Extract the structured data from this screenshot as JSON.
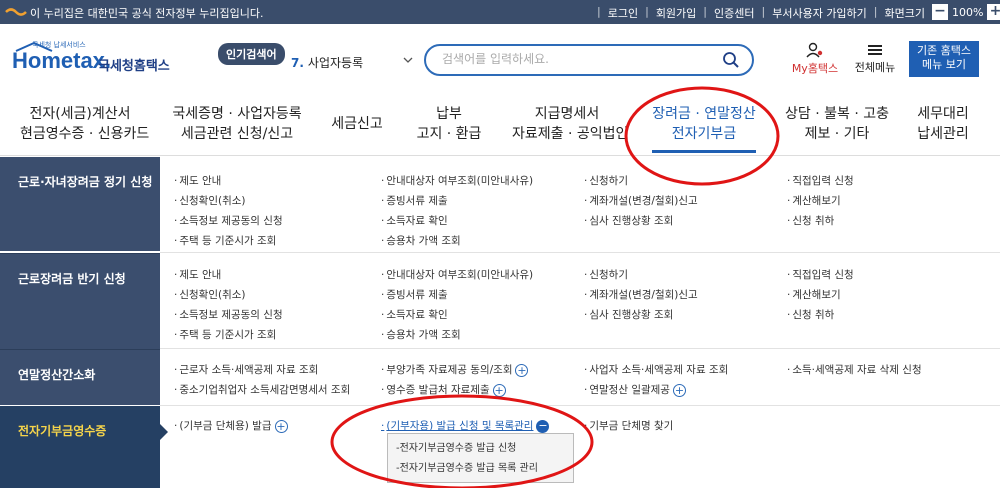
{
  "topbar": {
    "notice": "이 누리집은 대한민국 공식 전자정부 누리집입니다.",
    "links": [
      "로그인",
      "회원가입",
      "인증센터",
      "부서사용자 가입하기",
      "화면크기"
    ],
    "zoom": "100%",
    "zoom_minus": "−",
    "zoom_plus": "+"
  },
  "header": {
    "logo_small": "국세청 납세서비스",
    "logo_home": "Hometax.",
    "logo_org": "국세청홈택스",
    "popular_badge": "인기검색어",
    "popular_rank": "7.",
    "popular_term": "사업자등록",
    "search_placeholder": "검색어를 입력하세요.",
    "mytax": "My홈택스",
    "allmenu": "전체메뉴",
    "oldhome_line1": "기존 홈택스",
    "oldhome_line2": "메뉴 보기"
  },
  "nav": [
    {
      "l1": "전자(세금)계산서",
      "l2": "현금영수증 · 신용카드"
    },
    {
      "l1": "국세증명 · 사업자등록",
      "l2": "세금관련 신청/신고"
    },
    {
      "l1": "세금신고",
      "l2": ""
    },
    {
      "l1": "납부",
      "l2": "고지 · 환급"
    },
    {
      "l1": "지급명세서",
      "l2": "자료제출 · 공익법인"
    },
    {
      "l1": "장려금 · 연말정산",
      "l2": "전자기부금"
    },
    {
      "l1": "상담 · 불복 · 고충",
      "l2": "제보 · 기타"
    },
    {
      "l1": "세무대리",
      "l2": "납세관리"
    }
  ],
  "sections": [
    {
      "title": "근로·자녀장려금 정기 신청",
      "links": [
        "제도 안내",
        "신청확인(취소)",
        "소득정보 제공동의 신청",
        "주택 등 기준시가 조회",
        "안내대상자 여부조회(미안내사유)",
        "증빙서류 제출",
        "소득자료 확인",
        "승용차 가액 조회",
        "신청하기",
        "계좌개설(변경/철회)신고",
        "심사 진행상황 조회",
        "직접입력 신청",
        "계산해보기",
        "신청 취하"
      ]
    },
    {
      "title": "근로장려금 반기 신청",
      "links": [
        "제도 안내",
        "신청확인(취소)",
        "소득정보 제공동의 신청",
        "주택 등 기준시가 조회",
        "안내대상자 여부조회(미안내사유)",
        "증빙서류 제출",
        "소득자료 확인",
        "승용차 가액 조회",
        "신청하기",
        "계좌개설(변경/철회)신고",
        "심사 진행상황 조회",
        "직접입력 신청",
        "계산해보기",
        "신청 취하"
      ]
    },
    {
      "title": "연말정산간소화",
      "links": [
        "근로자 소득·세액공제 자료 조회",
        "중소기업취업자 소득세감면명세서 조회",
        "부양가족 자료제공 동의/조회",
        "영수증 발급처 자료제출",
        "사업자 소득·세액공제 자료 조회",
        "연말정산 일괄제공",
        "소득·세액공제 자료 삭제 신청"
      ]
    },
    {
      "title": "전자기부금영수증",
      "links": [
        "(기부금 단체용) 발급",
        "(기부자용) 발급 신청 및 목록관리",
        "기부금 단체명 찾기"
      ]
    }
  ],
  "submenu": [
    "전자기부금영수증 발급 신청",
    "전자기부금영수증 발급 목록 관리"
  ]
}
